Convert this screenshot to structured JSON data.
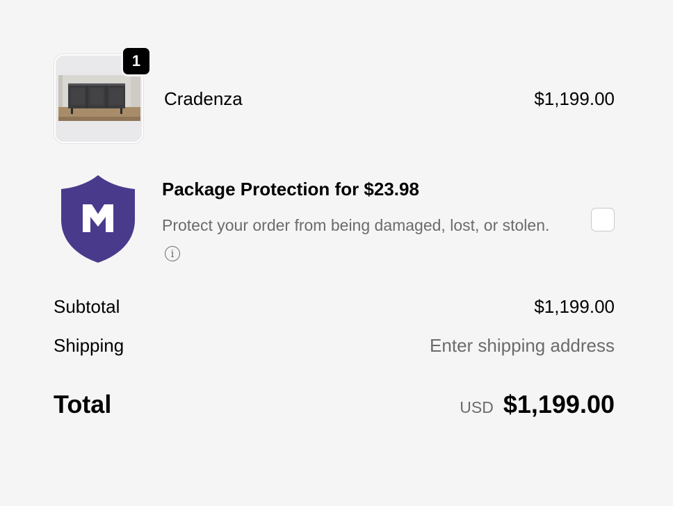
{
  "line_item": {
    "quantity": "1",
    "name": "Cradenza",
    "price": "$1,199.00",
    "image_alt": "cradenza-product-image"
  },
  "protection": {
    "title": "Package Protection for $23.98",
    "description": "Protect your order from being damaged, lost, or stolen.",
    "info_glyph": "i",
    "logo_letter": "M",
    "logo_color": "#4a3a8c",
    "checked": false
  },
  "summary": {
    "subtotal_label": "Subtotal",
    "subtotal_value": "$1,199.00",
    "shipping_label": "Shipping",
    "shipping_value": "Enter shipping address",
    "total_label": "Total",
    "currency": "USD",
    "total_value": "$1,199.00"
  }
}
